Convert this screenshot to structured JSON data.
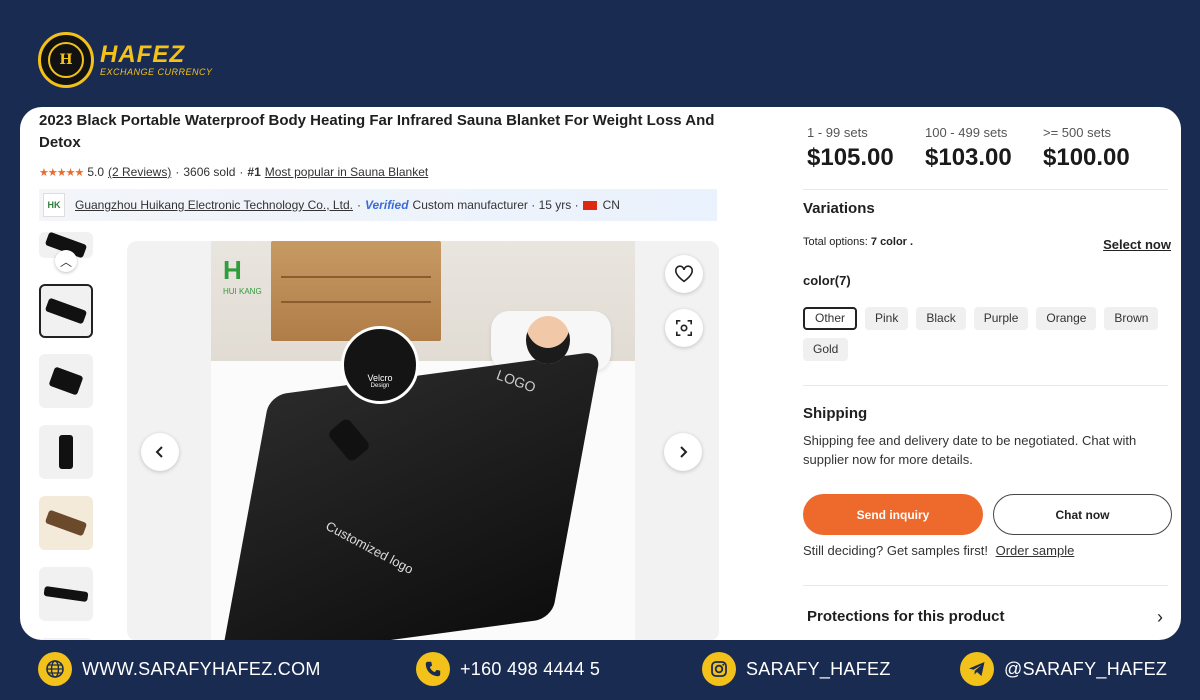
{
  "brand": {
    "name": "HAFEZ",
    "sub": "EXCHANGE CURRENCY",
    "seal_text": "H"
  },
  "product": {
    "title": "2023 Black Portable Waterproof Body Heating Far Infrared Sauna Blanket For Weight Loss And Detox",
    "rating": "5.0",
    "reviews": "(2 Reviews)",
    "sold": "3606 sold",
    "rank_prefix": "#1",
    "rank_text": "Most popular in Sauna Blanket",
    "supplier_name": "Guangzhou Huikang Electronic Technology Co., Ltd.",
    "verified": "Verified",
    "supplier_meta": "Custom manufacturer · 15 yrs ·",
    "country": "CN"
  },
  "gallery": {
    "logo_text": "HUI KANG",
    "velcro_title": "Velcro",
    "velcro_sub": "Design",
    "logo_label": "LOGO",
    "custom_label": "Customized logo"
  },
  "pricing": [
    {
      "qty": "1 - 99 sets",
      "price": "$105.00"
    },
    {
      "qty": "100 - 499 sets",
      "price": "$103.00"
    },
    {
      "qty": ">= 500 sets",
      "price": "$100.00"
    }
  ],
  "variations": {
    "title": "Variations",
    "total_label": "Total options:",
    "total_value": "7 color .",
    "select_now": "Select now",
    "color_label": "color(7)",
    "colors": [
      "Other",
      "Pink",
      "Black",
      "Purple",
      "Orange",
      "Brown",
      "Gold"
    ],
    "selected": "Other"
  },
  "shipping": {
    "title": "Shipping",
    "text": "Shipping fee and delivery date to be negotiated. Chat with supplier now for more details."
  },
  "actions": {
    "send_inquiry": "Send inquiry",
    "chat_now": "Chat now",
    "samples_text": "Still deciding? Get samples first!",
    "order_sample": "Order sample",
    "protections": "Protections for this product"
  },
  "footer": {
    "website": "WWW.SARAFYHAFEZ.COM",
    "phone": "+160 498 4444 5",
    "instagram": "SARAFY_HAFEZ",
    "telegram": "@SARAFY_HAFEZ"
  },
  "colors": {
    "background": "#1a2b52",
    "accent": "#f2c21a",
    "cta": "#ee6a2c"
  }
}
